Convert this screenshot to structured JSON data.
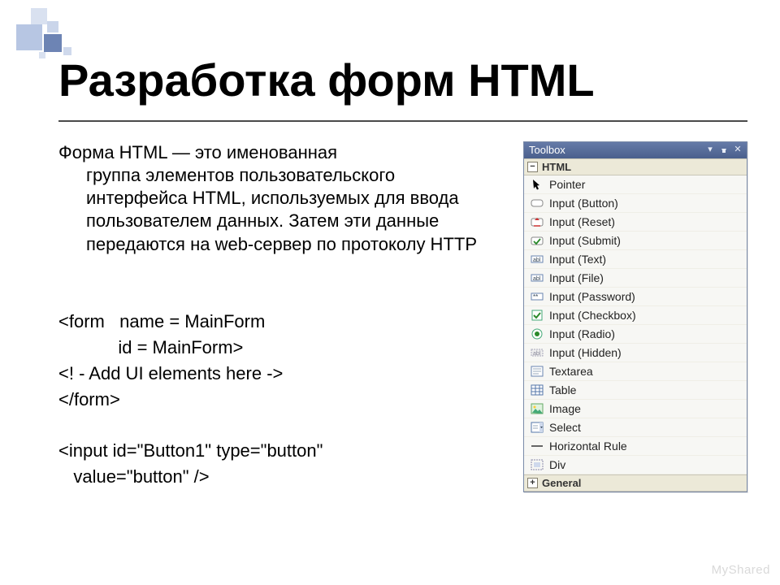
{
  "title": "Разработка форм HTML",
  "paragraph_head": "Форма HTML — это именованная",
  "paragraph_rest": "группа элементов пользовательского интерфейса HTML, используемых для ввода пользователем данных. Затем эти данные передаются на web-сервер по протоколу HTTP",
  "code_lines": [
    "<form   name = MainForm",
    "            id = MainForm>",
    "<! - Add UI elements here ->",
    "</form>",
    "",
    "<input id=\"Button1\" type=\"button\"",
    "   value=\"button\" />"
  ],
  "toolbox": {
    "title": "Toolbox",
    "section_open": "HTML",
    "section_closed": "General",
    "items": [
      {
        "label": "Pointer",
        "icon": "pointer"
      },
      {
        "label": "Input (Button)",
        "icon": "button"
      },
      {
        "label": "Input (Reset)",
        "icon": "reset"
      },
      {
        "label": "Input (Submit)",
        "icon": "submit"
      },
      {
        "label": "Input (Text)",
        "icon": "text"
      },
      {
        "label": "Input (File)",
        "icon": "text"
      },
      {
        "label": "Input (Password)",
        "icon": "password"
      },
      {
        "label": "Input (Checkbox)",
        "icon": "checkbox"
      },
      {
        "label": "Input (Radio)",
        "icon": "radio"
      },
      {
        "label": "Input (Hidden)",
        "icon": "hidden"
      },
      {
        "label": "Textarea",
        "icon": "textarea"
      },
      {
        "label": "Table",
        "icon": "table"
      },
      {
        "label": "Image",
        "icon": "image"
      },
      {
        "label": "Select",
        "icon": "select"
      },
      {
        "label": "Horizontal Rule",
        "icon": "hr"
      },
      {
        "label": "Div",
        "icon": "div"
      }
    ]
  },
  "watermark": "MyShared"
}
